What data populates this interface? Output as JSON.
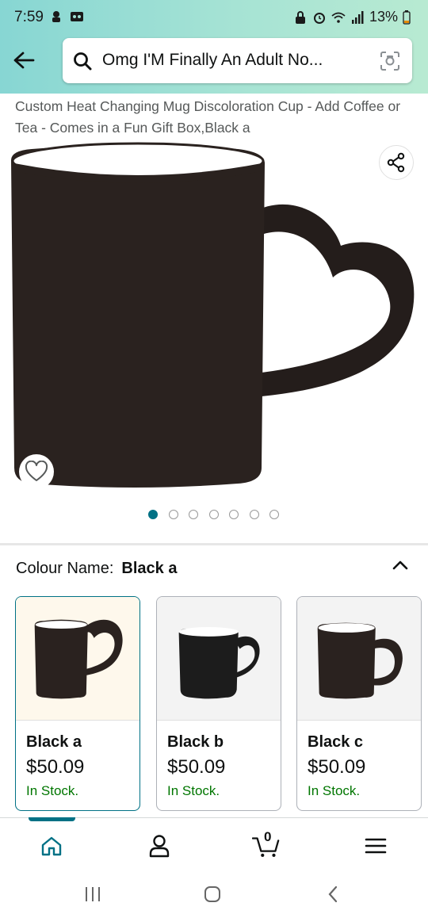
{
  "status_bar": {
    "time": "7:59",
    "battery": "13%"
  },
  "header": {
    "search_text": "Omg I'M Finally An Adult No..."
  },
  "product": {
    "title": "Custom Heat Changing Mug Discoloration Cup - Add Coffee or Tea - Comes in a Fun Gift Box,Black a",
    "image_dots_total": 7,
    "image_dots_active": 1
  },
  "variation": {
    "label": "Colour Name:",
    "selected": "Black a",
    "options": [
      {
        "name": "Black a",
        "price": "$50.09",
        "stock": "In Stock."
      },
      {
        "name": "Black b",
        "price": "$50.09",
        "stock": "In Stock."
      },
      {
        "name": "Black c",
        "price": "$50.09",
        "stock": "In Stock."
      }
    ]
  },
  "bottom_nav": {
    "cart_count": "0",
    "items": [
      "home-icon",
      "account-icon",
      "cart-icon",
      "menu-icon"
    ]
  },
  "colors": {
    "accent": "#007185",
    "in_stock": "#007600",
    "header_gradient_start": "#87d6d3",
    "header_gradient_end": "#b8ead2"
  }
}
